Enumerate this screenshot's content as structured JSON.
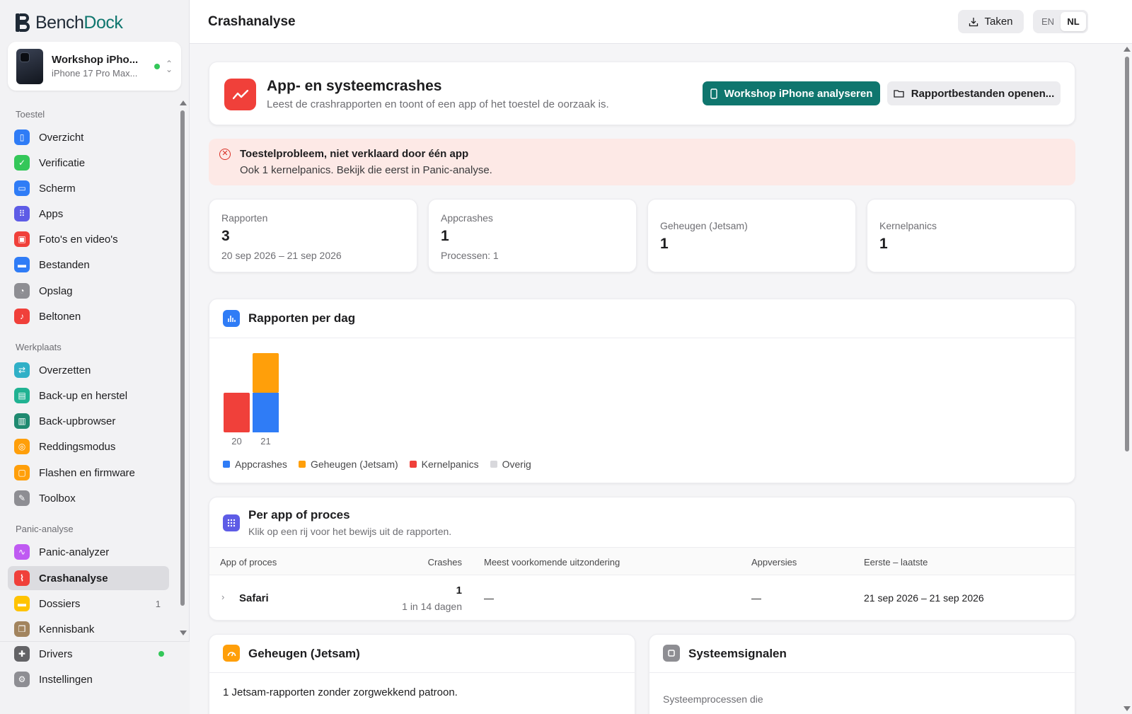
{
  "app": {
    "logo_part1": "Bench",
    "logo_part2": "Dock"
  },
  "device": {
    "name": "Workshop iPho...",
    "model": "iPhone 17 Pro Max..."
  },
  "sidebar": {
    "sections": [
      {
        "label": "Toestel"
      },
      {
        "label": "Werkplaats"
      },
      {
        "label": "Panic-analyse"
      }
    ],
    "items": [
      {
        "label": "Overzicht",
        "color": "#2f7cf6"
      },
      {
        "label": "Verificatie",
        "color": "#34c759"
      },
      {
        "label": "Scherm",
        "color": "#2f7cf6"
      },
      {
        "label": "Apps",
        "color": "#5e5ce6"
      },
      {
        "label": "Foto's en video's",
        "color": "#f0403a"
      },
      {
        "label": "Bestanden",
        "color": "#2f7cf6"
      },
      {
        "label": "Opslag",
        "color": "#8e8e93"
      },
      {
        "label": "Beltonen",
        "color": "#f0403a"
      },
      {
        "label": "Overzetten",
        "color": "#30b0c7"
      },
      {
        "label": "Back-up en herstel",
        "color": "#20b292"
      },
      {
        "label": "Back-upbrowser",
        "color": "#1f8a70"
      },
      {
        "label": "Reddingsmodus",
        "color": "#ff9f0a"
      },
      {
        "label": "Flashen en firmware",
        "color": "#ff9f0a"
      },
      {
        "label": "Toolbox",
        "color": "#8e8e93"
      },
      {
        "label": "Panic-analyzer",
        "color": "#bf5af2"
      },
      {
        "label": "Crashanalyse",
        "color": "#f0403a"
      },
      {
        "label": "Dossiers",
        "color": "#ffc300",
        "count": "1"
      },
      {
        "label": "Kennisbank",
        "color": "#a2845e"
      }
    ],
    "bottom": [
      {
        "label": "Drivers",
        "color": "#636366"
      },
      {
        "label": "Instellingen",
        "color": "#8e8e93"
      }
    ]
  },
  "header": {
    "title": "Crashanalyse",
    "tasks_label": "Taken",
    "lang_en": "EN",
    "lang_nl": "NL"
  },
  "hero": {
    "title": "App- en systeemcrashes",
    "subtitle": "Leest de crashrapporten en toont of een app of het toestel de oorzaak is.",
    "primary_button": "Workshop iPhone analyseren",
    "secondary_button": "Rapportbestanden openen..."
  },
  "alert": {
    "title": "Toestelprobleem, niet verklaard door één app",
    "text": "Ook 1 kernelpanics. Bekijk die eerst in Panic-analyse."
  },
  "stats": [
    {
      "label": "Rapporten",
      "value": "3",
      "sub": "20 sep 2026 – 21 sep 2026"
    },
    {
      "label": "Appcrashes",
      "value": "1",
      "sub": "Processen: 1"
    },
    {
      "label": "Geheugen (Jetsam)",
      "value": "1",
      "sub": ""
    },
    {
      "label": "Kernelpanics",
      "value": "1",
      "sub": ""
    }
  ],
  "chart_data": {
    "type": "bar",
    "stacked": true,
    "title": "Rapporten per dag",
    "categories": [
      "20",
      "21"
    ],
    "series": [
      {
        "name": "Appcrashes",
        "color": "#2f7cf6",
        "values": [
          0,
          1
        ]
      },
      {
        "name": "Geheugen (Jetsam)",
        "color": "#ff9f0a",
        "values": [
          0,
          1
        ]
      },
      {
        "name": "Kernelpanics",
        "color": "#f0403a",
        "values": [
          1,
          0
        ]
      },
      {
        "name": "Overig",
        "color": "#d8d8dc",
        "values": [
          0,
          0
        ]
      }
    ],
    "legend": "bottom-left",
    "grid": false
  },
  "per_app": {
    "title": "Per app of proces",
    "subtitle": "Klik op een rij voor het bewijs uit de rapporten.",
    "columns": [
      "App of proces",
      "Crashes",
      "Meest voorkomende uitzondering",
      "Appversies",
      "Eerste – laatste"
    ],
    "rows": [
      {
        "app": "Safari",
        "crashes": "1",
        "crashes_sub": "1 in 14 dagen",
        "exception": "—",
        "versions": "—",
        "range": "21 sep 2026 – 21 sep 2026"
      }
    ]
  },
  "jetsam": {
    "title": "Geheugen (Jetsam)",
    "text": "1 Jetsam-rapporten zonder zorgwekkend patroon."
  },
  "signals": {
    "title": "Systeemsignalen",
    "text": "Systeemprocessen die"
  }
}
